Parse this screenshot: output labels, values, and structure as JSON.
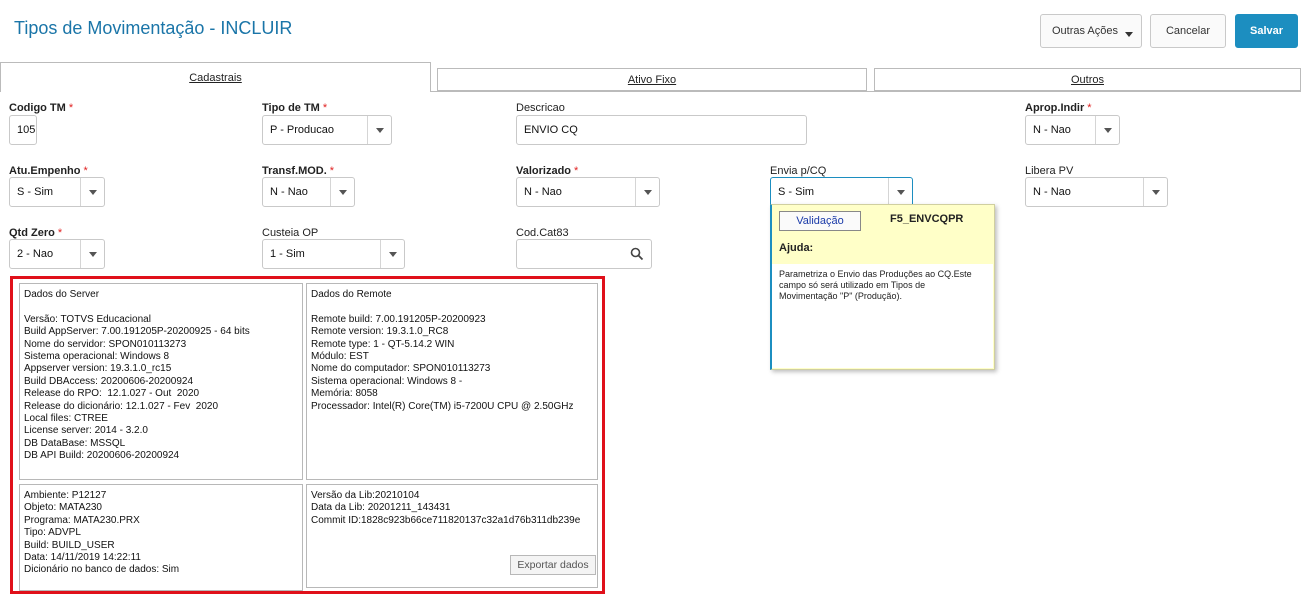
{
  "header": {
    "title": "Tipos de Movimentação - INCLUIR",
    "more_actions": "Outras Ações",
    "cancel": "Cancelar",
    "save": "Salvar"
  },
  "tabs": [
    "Cadastrais",
    "Ativo Fixo",
    "Outros"
  ],
  "fields": {
    "codigo_tm": {
      "label": "Codigo TM",
      "value": "105"
    },
    "tipo_tm": {
      "label": "Tipo de TM",
      "value": "P - Producao"
    },
    "descricao": {
      "label": "Descricao",
      "value": "ENVIO CQ"
    },
    "aprop_indir": {
      "label": "Aprop.Indir",
      "value": "N - Nao"
    },
    "atu_empenho": {
      "label": "Atu.Empenho",
      "value": "S - Sim"
    },
    "transf_mod": {
      "label": "Transf.MOD.",
      "value": "N - Nao"
    },
    "valorizado": {
      "label": "Valorizado",
      "value": "N - Nao"
    },
    "envia_cq": {
      "label": "Envia p/CQ",
      "value": "S - Sim"
    },
    "libera_pv": {
      "label": "Libera PV",
      "value": "N - Nao"
    },
    "qtd_zero": {
      "label": "Qtd Zero",
      "value": "2 - Nao"
    },
    "custeia_op": {
      "label": "Custeia OP",
      "value": "1 - Sim"
    },
    "cod_cat83": {
      "label": "Cod.Cat83",
      "value": ""
    }
  },
  "required_mark": "*",
  "help": {
    "button": "Validação",
    "code": "F5_ENVCQPR",
    "title": "Ajuda:",
    "text": "Parametriza o Envio das Produções ao CQ.Este campo só será utilizado em Tipos de Movimentação \"P\" (Produção)."
  },
  "info": {
    "server": "Dados do Server\n\nVersão: TOTVS Educacional\nBuild AppServer: 7.00.191205P-20200925 - 64 bits\nNome do servidor: SPON010113273\nSistema operacional: Windows 8\nAppserver version: 19.3.1.0_rc15\nBuild DBAccess: 20200606-20200924\nRelease do RPO:  12.1.027 - Out  2020\nRelease do dicionário: 12.1.027 - Fev  2020\nLocal files: CTREE\nLicense server: 2014 - 3.2.0\nDB DataBase: MSSQL\nDB API Build: 20200606-20200924",
    "remote": "Dados do Remote\n\nRemote build: 7.00.191205P-20200923\nRemote version: 19.3.1.0_RC8\nRemote type: 1 - QT-5.14.2 WIN\nMódulo: EST\nNome do computador: SPON010113273\nSistema operacional: Windows 8 -\nMemória: 8058\nProcessador: Intel(R) Core(TM) i5-7200U CPU @ 2.50GHz",
    "environment": "Ambiente: P12127\nObjeto: MATA230\nPrograma: MATA230.PRX\nTipo: ADVPL\nBuild: BUILD_USER\nData: 14/11/2019 14:22:11\nDicionário no banco de dados: Sim",
    "lib": "Versão da Lib:20210104\nData da Lib: 20201211_143431\nCommit ID:1828c923b66ce711820137c32a1d76b311db239e",
    "export": "Exportar dados"
  }
}
